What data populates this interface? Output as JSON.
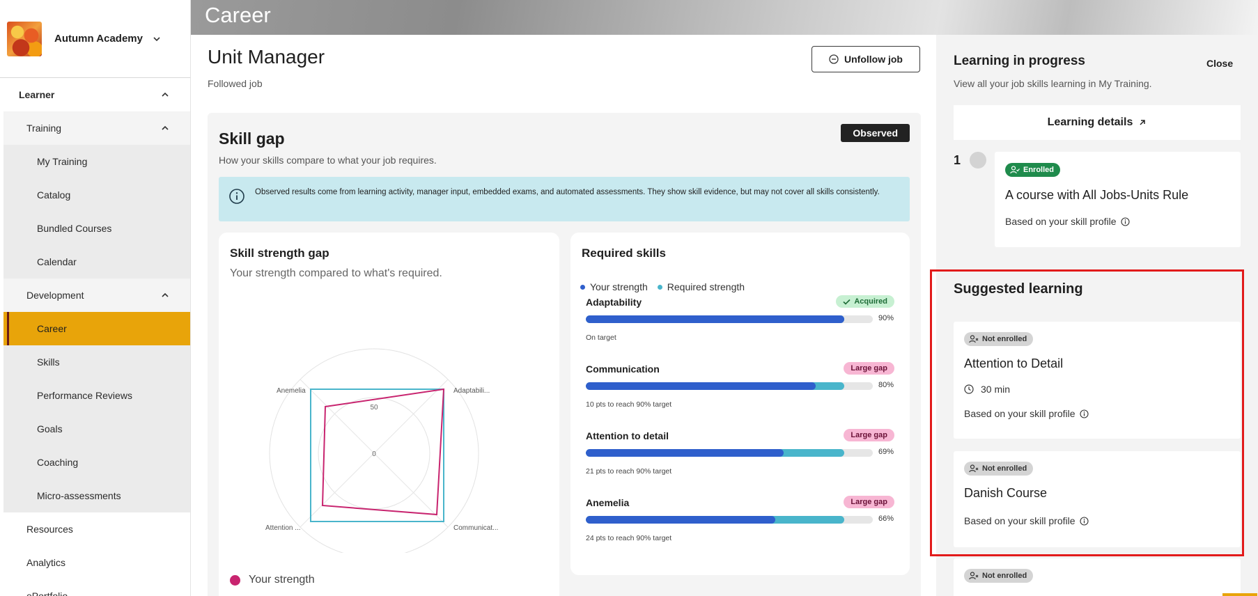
{
  "org": {
    "name": "Autumn Academy"
  },
  "sidebar": {
    "items": [
      {
        "label": "Learner"
      },
      {
        "label": "Training"
      },
      {
        "label": "My Training"
      },
      {
        "label": "Catalog"
      },
      {
        "label": "Bundled Courses"
      },
      {
        "label": "Calendar"
      },
      {
        "label": "Development"
      },
      {
        "label": "Career"
      },
      {
        "label": "Skills"
      },
      {
        "label": "Performance Reviews"
      },
      {
        "label": "Goals"
      },
      {
        "label": "Coaching"
      },
      {
        "label": "Micro-assessments"
      },
      {
        "label": "Resources"
      },
      {
        "label": "Analytics"
      },
      {
        "label": "ePortfolio"
      }
    ]
  },
  "banner": {
    "title": "Career"
  },
  "job": {
    "title": "Unit Manager",
    "subtitle": "Followed job",
    "unfollow_label": "Unfollow job"
  },
  "skill_gap": {
    "title": "Skill gap",
    "subtitle": "How your skills compare to what your job requires.",
    "badge": "Observed",
    "info": "Observed results come from learning activity, manager input, embedded exams, and automated assessments. They show skill evidence, but may not cover all skills consistently."
  },
  "radar": {
    "title": "Skill strength gap",
    "subtitle": "Your strength compared to what's required.",
    "axis_labels": [
      "Anemelia",
      "Adaptabili...",
      "Communicat...",
      "Attention ..."
    ],
    "tick_labels": [
      "0",
      "50"
    ],
    "legend_strength": "Your strength",
    "colors": {
      "your": "#c8246f",
      "required": "#49b5cb"
    }
  },
  "required_skills": {
    "title": "Required skills",
    "legend_your": "Your strength",
    "legend_required": "Required strength",
    "skills": [
      {
        "name": "Adaptability",
        "badge": "Acquired",
        "badge_type": "acquired",
        "your": 90,
        "required": 90,
        "pct_label": "90%",
        "note": "On target"
      },
      {
        "name": "Communication",
        "badge": "Large gap",
        "badge_type": "large",
        "your": 80,
        "required": 90,
        "pct_label": "80%",
        "note": "10 pts to reach 90% target"
      },
      {
        "name": "Attention to detail",
        "badge": "Large gap",
        "badge_type": "large",
        "your": 69,
        "required": 90,
        "pct_label": "69%",
        "note": "21 pts to reach 90% target"
      },
      {
        "name": "Anemelia",
        "badge": "Large gap",
        "badge_type": "large",
        "your": 66,
        "required": 90,
        "pct_label": "66%",
        "note": "24 pts to reach 90% target"
      }
    ]
  },
  "learning_in_progress": {
    "title": "Learning in progress",
    "close_label": "Close",
    "subtitle": "View all your job skills learning in My Training.",
    "details_label": "Learning details",
    "step": "1",
    "course": {
      "status": "Enrolled",
      "name": "A course with All Jobs-Units Rule",
      "based_on": "Based on your skill profile"
    }
  },
  "suggested_learning": {
    "title": "Suggested learning",
    "courses": [
      {
        "status": "Not enrolled",
        "name": "Attention to Detail",
        "duration": "30 min",
        "based_on": "Based on your skill profile"
      },
      {
        "status": "Not enrolled",
        "name": "Danish Course",
        "based_on": "Based on your skill profile"
      },
      {
        "status": "Not enrolled"
      }
    ]
  }
}
